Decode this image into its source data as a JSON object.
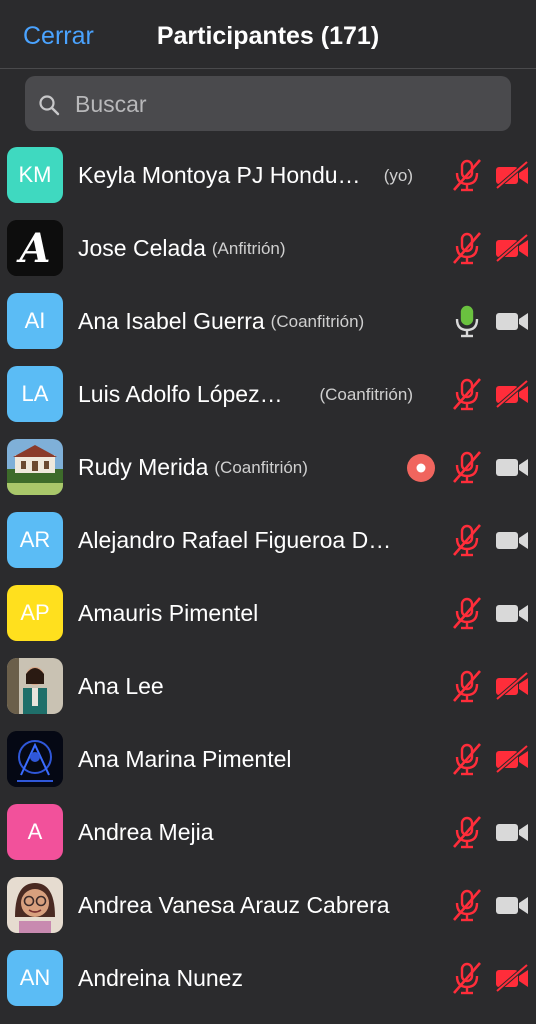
{
  "header": {
    "close_label": "Cerrar",
    "title": "Participantes (171)"
  },
  "search": {
    "placeholder": "Buscar"
  },
  "colors": {
    "accent": "#4aa3ff",
    "muted_red": "#ff2d3a",
    "mic_on_green": "#6ac13f",
    "icon_gray": "#d9d9d9"
  },
  "participants": [
    {
      "initials": "KM",
      "avatar_color": "#3fd9c0",
      "name": "Keyla Montoya PJ Hondu…",
      "role": "(yo)",
      "mic": "muted",
      "video": "off",
      "recording": false
    },
    {
      "initials": "",
      "avatar_image": "script-letter-a",
      "name": "Jose Celada",
      "role": "(Anfitrión)",
      "mic": "muted",
      "video": "off",
      "recording": false
    },
    {
      "initials": "AI",
      "avatar_color": "#5bbcf5",
      "name": "Ana Isabel Guerra",
      "role": "(Coanfitrión)",
      "mic": "on",
      "video": "on",
      "recording": false
    },
    {
      "initials": "LA",
      "avatar_color": "#5bbcf5",
      "name": "Luis Adolfo López…",
      "role": "(Coanfitrión)",
      "mic": "muted",
      "video": "off",
      "recording": false
    },
    {
      "initials": "",
      "avatar_image": "building-photo",
      "name": "Rudy Merida",
      "role": "(Coanfitrión)",
      "mic": "muted",
      "video": "on",
      "recording": true
    },
    {
      "initials": "AR",
      "avatar_color": "#5bbcf5",
      "name": "Alejandro Rafael Figueroa D…",
      "role": "",
      "mic": "muted",
      "video": "on",
      "recording": false
    },
    {
      "initials": "AP",
      "avatar_color": "#ffe01e",
      "name": "Amauris Pimentel",
      "role": "",
      "mic": "muted",
      "video": "on",
      "recording": false
    },
    {
      "initials": "",
      "avatar_image": "woman-photo",
      "name": "Ana Lee",
      "role": "",
      "mic": "muted",
      "video": "off",
      "recording": false
    },
    {
      "initials": "",
      "avatar_image": "blue-emblem",
      "name": "Ana Marina Pimentel",
      "role": "",
      "mic": "muted",
      "video": "off",
      "recording": false
    },
    {
      "initials": "A",
      "avatar_color": "#f2519b",
      "name": "Andrea Mejia",
      "role": "",
      "mic": "muted",
      "video": "on",
      "recording": false
    },
    {
      "initials": "",
      "avatar_image": "girl-glasses-photo",
      "name": "Andrea Vanesa Arauz Cabrera",
      "role": "",
      "mic": "muted",
      "video": "on",
      "recording": false
    },
    {
      "initials": "AN",
      "avatar_color": "#5bbcf5",
      "name": "Andreina Nunez",
      "role": "",
      "mic": "muted",
      "video": "off",
      "recording": false
    }
  ]
}
